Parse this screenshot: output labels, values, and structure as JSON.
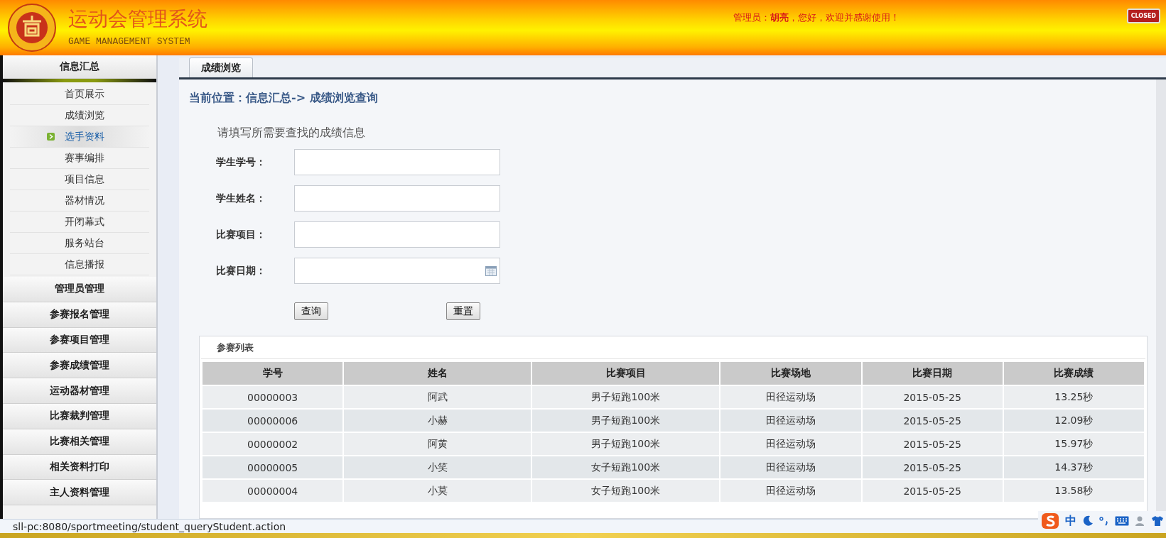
{
  "header": {
    "title": "运动会管理系统",
    "subtitle": "GAME MANAGEMENT SYSTEM",
    "welcome": "管理员：**胡亮**，您好，欢迎并感谢使用！",
    "close_button": "CLOSED"
  },
  "sidebar": {
    "groups": [
      {
        "label": "信息汇总",
        "expanded": true,
        "children": [
          {
            "label": "首页展示",
            "selected": false
          },
          {
            "label": "成绩浏览",
            "selected": false
          },
          {
            "label": "选手资料",
            "selected": true
          },
          {
            "label": "赛事编排",
            "selected": false
          },
          {
            "label": "项目信息",
            "selected": false
          },
          {
            "label": "器材情况",
            "selected": false
          },
          {
            "label": "开闭幕式",
            "selected": false
          },
          {
            "label": "服务站台",
            "selected": false
          },
          {
            "label": "信息播报",
            "selected": false
          }
        ]
      },
      {
        "label": "管理员管理",
        "expanded": false
      },
      {
        "label": "参赛报名管理",
        "expanded": false
      },
      {
        "label": "参赛项目管理",
        "expanded": false
      },
      {
        "label": "参赛成绩管理",
        "expanded": false
      },
      {
        "label": "运动器材管理",
        "expanded": false
      },
      {
        "label": "比赛裁判管理",
        "expanded": false
      },
      {
        "label": "比赛相关管理",
        "expanded": false
      },
      {
        "label": "相关资料打印",
        "expanded": false
      },
      {
        "label": "主人资料管理",
        "expanded": false
      }
    ]
  },
  "tabs": [
    {
      "label": "成绩浏览",
      "selected": true
    }
  ],
  "breadcrumb": "当前位置：信息汇总-> 成绩浏览查询",
  "form": {
    "title": "请填写所需要查找的成绩信息",
    "fields": [
      {
        "label": "学生学号：",
        "kind": "text"
      },
      {
        "label": "学生姓名：",
        "kind": "text"
      },
      {
        "label": "比赛项目：",
        "kind": "text"
      },
      {
        "label": "比赛日期：",
        "kind": "date"
      }
    ],
    "buttons": [
      "查询",
      "重置"
    ]
  },
  "table": {
    "title": "参赛列表",
    "columns": [
      "学号",
      "姓名",
      "比赛项目",
      "比赛场地",
      "比赛日期",
      "比赛成绩"
    ],
    "rows": [
      [
        "00000003",
        "阿武",
        "男子短跑100米",
        "田径运动场",
        "2015-05-25",
        "13.25秒"
      ],
      [
        "00000006",
        "小赫",
        "男子短跑100米",
        "田径运动场",
        "2015-05-25",
        "12.09秒"
      ],
      [
        "00000002",
        "阿黄",
        "男子短跑100米",
        "田径运动场",
        "2015-05-25",
        "15.97秒"
      ],
      [
        "00000005",
        "小笑",
        "女子短跑100米",
        "田径运动场",
        "2015-05-25",
        "14.37秒"
      ],
      [
        "00000004",
        "小莫",
        "女子短跑100米",
        "田径运动场",
        "2015-05-25",
        "13.58秒"
      ]
    ]
  },
  "status_bar": {
    "url": "sll-pc:8080/sportmeeting/student_queryStudent.action",
    "ime_mode": "中"
  }
}
